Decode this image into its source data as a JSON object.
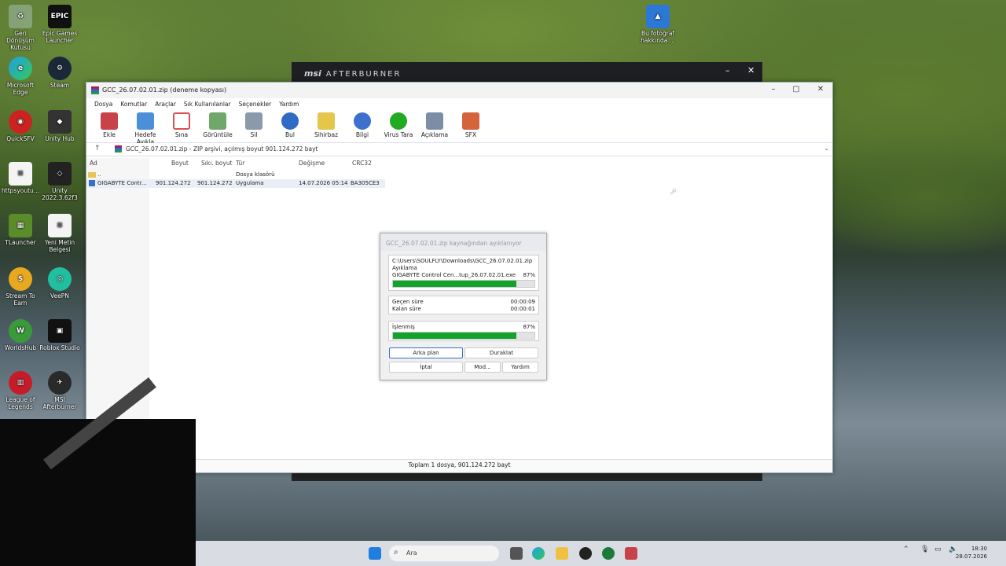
{
  "desktop": {
    "icons": [
      {
        "label": "Geri Dönüşüm Kutusu",
        "icon": "recycle-bin-icon"
      },
      {
        "label": "Epic Games Launcher",
        "icon": "epic-games-icon",
        "glyph": "EPIC"
      },
      {
        "label": "Microsoft Edge",
        "icon": "edge-icon"
      },
      {
        "label": "Steam",
        "icon": "steam-icon"
      },
      {
        "label": "QuickSFV",
        "icon": "quicksfv-icon"
      },
      {
        "label": "Unity Hub",
        "icon": "unity-hub-icon"
      },
      {
        "label": "httpsyoutu...",
        "icon": "text-file-icon"
      },
      {
        "label": "Unity 2022.3.62f3",
        "icon": "unity-icon"
      },
      {
        "label": "TLauncher",
        "icon": "tlauncher-icon"
      },
      {
        "label": "Yeni Metin Belgesi",
        "icon": "text-document-icon"
      },
      {
        "label": "Stream To Earn",
        "icon": "stream-to-earn-icon"
      },
      {
        "label": "VeePN",
        "icon": "veepn-icon"
      },
      {
        "label": "WorldsHub",
        "icon": "worldshub-icon"
      },
      {
        "label": "Roblox Studio",
        "icon": "roblox-studio-icon"
      },
      {
        "label": "League of Legends",
        "icon": "league-icon"
      },
      {
        "label": "MSI Afterburner",
        "icon": "msi-afterburner-icon"
      },
      {
        "label": "Bu fotoğraf hakkında ...",
        "icon": "photo-info-icon"
      }
    ]
  },
  "afterburner": {
    "brand": "msi",
    "title": "AFTERBURNER",
    "minimize": "–",
    "close": "✕"
  },
  "winrar": {
    "title": "GCC_26.07.02.01.zip (deneme kopyası)",
    "window_buttons": {
      "minimize": "–",
      "maximize": "▢",
      "close": "✕"
    },
    "menu": [
      "Dosya",
      "Komutlar",
      "Araçlar",
      "Sık Kullanılanlar",
      "Seçenekler",
      "Yardım"
    ],
    "toolbar": [
      {
        "label": "Ekle",
        "icon": "add-archive-icon",
        "color": "#c8424a"
      },
      {
        "label": "Hedefe Ayıkla",
        "icon": "extract-folder-icon",
        "color": "#4a8fd8"
      },
      {
        "label": "Sına",
        "icon": "test-icon",
        "color": "#d95050"
      },
      {
        "label": "Görüntüle",
        "icon": "view-icon",
        "color": "#6fa86a"
      },
      {
        "label": "Sil",
        "icon": "delete-icon",
        "color": "#8a9aaa"
      },
      {
        "label": "Bul",
        "icon": "find-icon",
        "color": "#2f6ac5"
      },
      {
        "label": "Sihirbaz",
        "icon": "wizard-icon",
        "color": "#e3c64a"
      },
      {
        "label": "Bilgi",
        "icon": "info-icon",
        "color": "#3d6fcc"
      },
      {
        "label": "Virus Tara",
        "icon": "virus-scan-icon",
        "color": "#22aa22"
      },
      {
        "label": "Açıklama",
        "icon": "comment-icon",
        "color": "#7c8ea6"
      },
      {
        "label": "SFX",
        "icon": "sfx-icon",
        "color": "#d3643b"
      }
    ],
    "address": "GCC_26.07.02.01.zip - ZIP arşivi, açılmış boyut 901.124.272 bayt",
    "columns": [
      "Ad",
      "Boyut",
      "Sıkı. boyut",
      "Tür",
      "Değişme",
      "CRC32"
    ],
    "rows": [
      {
        "name": "..",
        "size": "",
        "packed": "",
        "type": "Dosya klasörü",
        "modified": "",
        "crc": ""
      },
      {
        "name": "GIGABYTE Contr...",
        "size": "901.124.272",
        "packed": "901.124.272",
        "type": "Uygulama",
        "modified": "14.07.2026 05:14",
        "crc": "BA305CE3"
      }
    ],
    "status": "Toplam 1 dosya, 901.124.272 bayt"
  },
  "dialog": {
    "title": "GCC_26.07.02.01.zip kaynağından ayıklanıyor",
    "source_path": "C:\\Users\\SOULFLY\\Downloads\\GCC_26.07.02.01.zip",
    "action": "Ayıklama",
    "current_file": "GIGABYTE Control Cen...tup_26.07.02.01.exe",
    "current_percent_text": "87%",
    "current_progress": 0.87,
    "elapsed_label": "Geçen süre",
    "elapsed_value": "00:00:09",
    "remaining_label": "Kalan süre",
    "remaining_value": "00:00:01",
    "processed_label": "İşlenmiş",
    "processed_percent_text": "87%",
    "processed_progress": 0.87,
    "buttons": {
      "background": "Arka plan",
      "pause": "Duraklat",
      "cancel": "İptal",
      "mode": "Mod...",
      "help": "Yardım"
    }
  },
  "taskbar": {
    "search_placeholder": "Ara",
    "time": "18:30",
    "date": "28.07.2026"
  }
}
